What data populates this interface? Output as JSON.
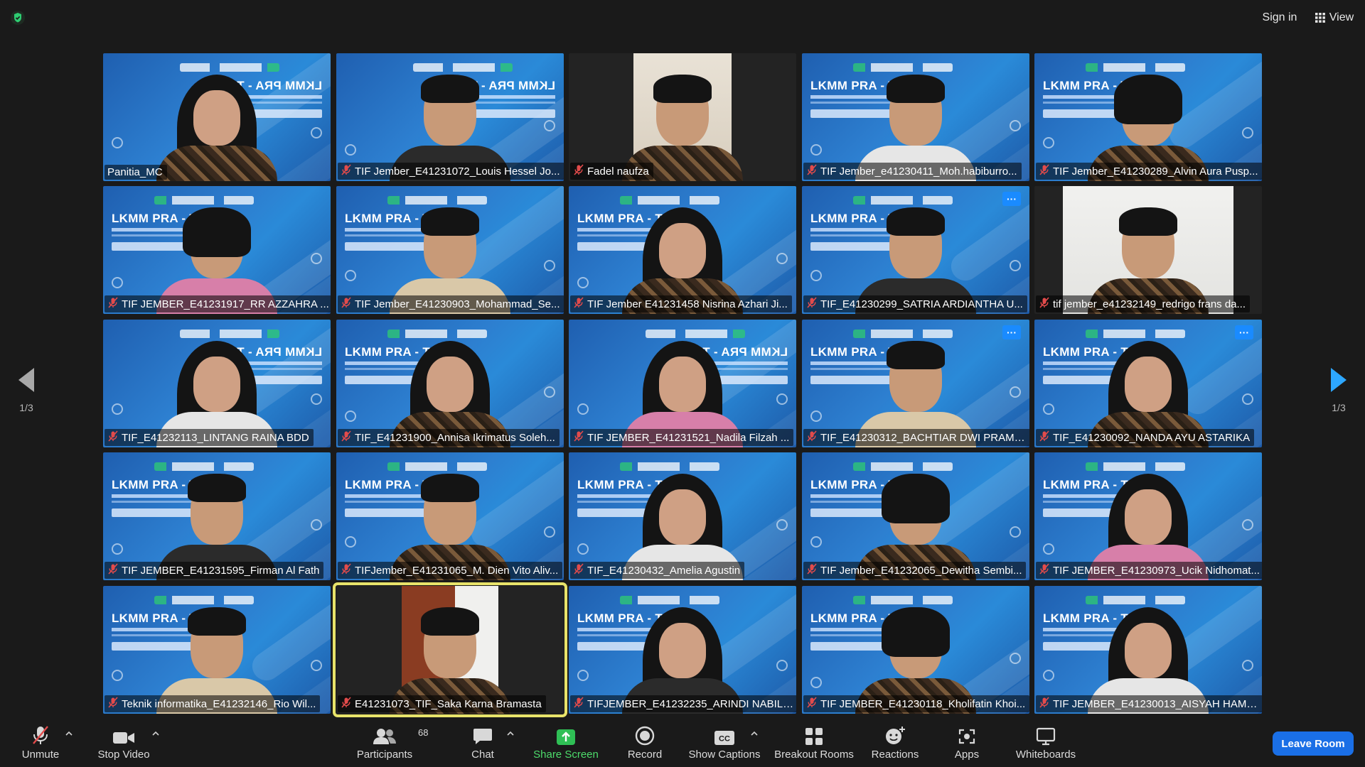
{
  "topbar": {
    "signin_label": "Sign in",
    "view_label": "View",
    "security_icon": "shield-check-icon"
  },
  "pagination": {
    "left_label": "1/3",
    "right_label": "1/3"
  },
  "participants": [
    {
      "name": "Panitia_MC",
      "muted": false,
      "type": "hijab",
      "bg": "banner-mirror"
    },
    {
      "name": "TIF Jember_E41231072_Louis Hessel Jo...",
      "muted": true,
      "type": "male",
      "bg": "banner-mirror"
    },
    {
      "name": "Fadel naufza",
      "muted": true,
      "type": "male",
      "bg": "room"
    },
    {
      "name": "TIF Jember_e41230411_Moh.habiburro...",
      "muted": true,
      "type": "male",
      "bg": "banner"
    },
    {
      "name": "TIF Jember_E41230289_Alvin Aura Pusp...",
      "muted": true,
      "type": "female",
      "bg": "banner"
    },
    {
      "name": "TIF JEMBER_E41231917_RR AZZAHRA ...",
      "muted": true,
      "type": "female",
      "bg": "banner"
    },
    {
      "name": "TIF Jember_E41230903_Mohammad_Se...",
      "muted": true,
      "type": "male",
      "bg": "banner"
    },
    {
      "name": "TIF Jember E41231458 Nisrina Azhari Ji...",
      "muted": true,
      "type": "hijab",
      "bg": "banner"
    },
    {
      "name": "TIF_E41230299_SATRIA ARDIANTHA U...",
      "muted": true,
      "type": "male",
      "bg": "banner",
      "more": true
    },
    {
      "name": "tif jember_e41232149_redrigo frans da...",
      "muted": true,
      "type": "male",
      "bg": "room-white"
    },
    {
      "name": "TIF_E41232113_LINTANG RAINA BDD",
      "muted": true,
      "type": "hijab",
      "bg": "banner-mirror"
    },
    {
      "name": "TIF_E41231900_Annisa Ikrimatus Soleh...",
      "muted": true,
      "type": "hijab",
      "bg": "banner"
    },
    {
      "name": "TIF JEMBER_E41231521_Nadila Filzah ...",
      "muted": true,
      "type": "hijab",
      "bg": "banner-mirror"
    },
    {
      "name": "TIF_E41230312_BACHTIAR DWI PRAMU...",
      "muted": true,
      "type": "male",
      "bg": "banner",
      "more": true
    },
    {
      "name": "TIF_E41230092_NANDA AYU ASTARIKA",
      "muted": true,
      "type": "hijab",
      "bg": "banner",
      "more": true
    },
    {
      "name": "TIF JEMBER_E41231595_Firman Al Fath",
      "muted": true,
      "type": "male",
      "bg": "banner"
    },
    {
      "name": "TIFJember_E41231065_M. Dien Vito Aliv...",
      "muted": true,
      "type": "male",
      "bg": "banner"
    },
    {
      "name": "TIF_E41230432_Amelia Agustin",
      "muted": true,
      "type": "hijab",
      "bg": "banner"
    },
    {
      "name": "TIF Jember_E41232065_Dewitha Sembi...",
      "muted": true,
      "type": "female",
      "bg": "banner"
    },
    {
      "name": "TIF JEMBER_E41230973_Ucik Nidhomat...",
      "muted": true,
      "type": "hijab",
      "bg": "banner"
    },
    {
      "name": "Teknik informatika_E41232146_Rio Wil...",
      "muted": true,
      "type": "male",
      "bg": "banner"
    },
    {
      "name": "E41231073_TIF_Saka Karna Bramasta",
      "muted": true,
      "type": "male",
      "bg": "door",
      "active": true
    },
    {
      "name": "TIFJEMBER_E41232235_ARINDI NABILA...",
      "muted": true,
      "type": "hijab",
      "bg": "banner"
    },
    {
      "name": "TIF JEMBER_E41230118_Kholifatin Khoi...",
      "muted": true,
      "type": "female",
      "bg": "banner"
    },
    {
      "name": "TIF JEMBER_E41230013_AISYAH HAMDA",
      "muted": true,
      "type": "hijab",
      "bg": "banner"
    }
  ],
  "toolbar": {
    "unmute_label": "Unmute",
    "stop_video_label": "Stop Video",
    "participants_label": "Participants",
    "participants_count": "68",
    "chat_label": "Chat",
    "share_label": "Share Screen",
    "record_label": "Record",
    "captions_label": "Show Captions",
    "breakout_label": "Breakout Rooms",
    "reactions_label": "Reactions",
    "apps_label": "Apps",
    "whiteboards_label": "Whiteboards",
    "leave_label": "Leave Room"
  },
  "banner_text": "LKMM PRA - TD",
  "colors": {
    "accent": "#1a6fe6",
    "share_green": "#4ddb6b",
    "active_border": "#e8e36a",
    "mute_red": "#e24b4b"
  }
}
